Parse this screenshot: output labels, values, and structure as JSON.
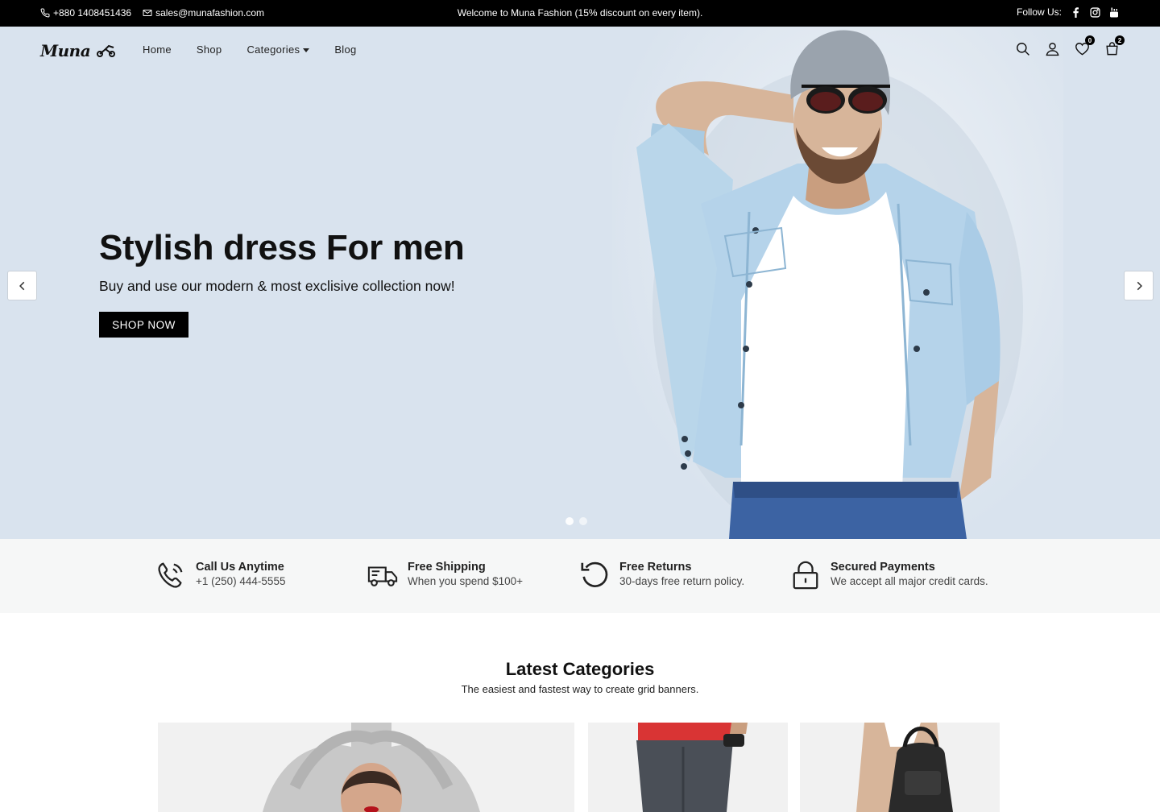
{
  "topbar": {
    "phone": "+880 1408451436",
    "email": "sales@munafashion.com",
    "welcome": "Welcome to Muna Fashion (15% discount on every item).",
    "follow_label": "Follow Us:",
    "socials": [
      "facebook-icon",
      "instagram-icon",
      "youtube-icon"
    ]
  },
  "nav": {
    "logo": "Muna",
    "items": [
      "Home",
      "Shop",
      "Categories",
      "Blog"
    ],
    "wishlist_count": "0",
    "cart_count": "2"
  },
  "hero": {
    "title": "Stylish dress For men",
    "subtitle": "Buy and use our modern & most exclisive collection now!",
    "button": "SHOP NOW",
    "slides": 2,
    "active_slide": 1
  },
  "features": [
    {
      "title": "Call Us Anytime",
      "subtitle": "+1 (250) 444-5555",
      "icon": "phone-icon"
    },
    {
      "title": "Free Shipping",
      "subtitle": "When you spend $100+",
      "icon": "truck-icon"
    },
    {
      "title": "Free Returns",
      "subtitle": "30-days free return policy.",
      "icon": "return-icon"
    },
    {
      "title": "Secured Payments",
      "subtitle": "We accept all major credit cards.",
      "icon": "lock-icon"
    }
  ],
  "categories": {
    "title": "Latest Categories",
    "subtitle": "The easiest and fastest way to create grid banners."
  },
  "colors": {
    "topbar_bg": "#000000",
    "hero_bg": "#d9e3ee",
    "features_bg": "#f6f7f7",
    "accent": "#000000"
  }
}
